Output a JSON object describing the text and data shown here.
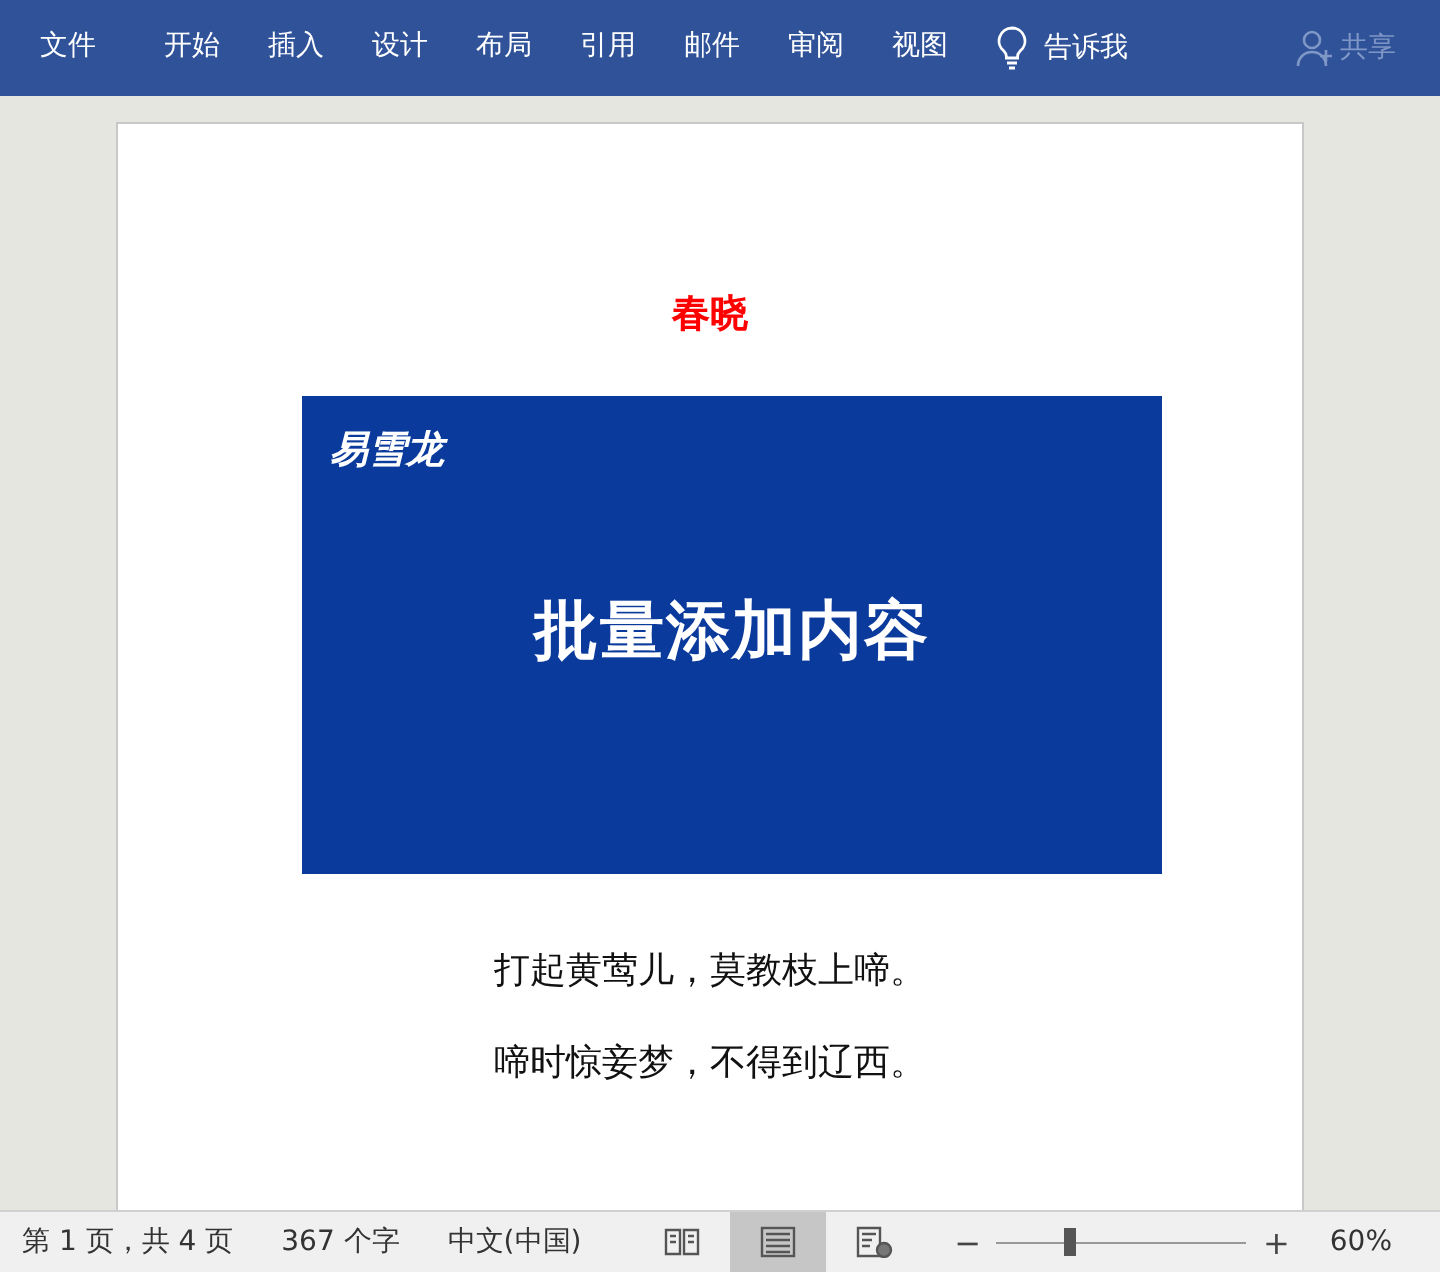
{
  "ribbon": {
    "tabs": [
      {
        "label": "文件",
        "selected": false
      },
      {
        "label": "开始",
        "selected": false
      },
      {
        "label": "插入",
        "selected": false
      },
      {
        "label": "设计",
        "selected": false
      },
      {
        "label": "布局",
        "selected": false
      },
      {
        "label": "引用",
        "selected": false
      },
      {
        "label": "邮件",
        "selected": false
      },
      {
        "label": "审阅",
        "selected": false
      },
      {
        "label": "视图",
        "selected": false
      }
    ],
    "tell_me": "告诉我",
    "share": {
      "label": "共享",
      "disabled": true
    }
  },
  "document": {
    "title": "春晓",
    "lines": [
      "打起黄莺儿，莫教枝上啼。",
      "啼时惊妾梦，不得到辽西。"
    ]
  },
  "overlay": {
    "brand": "易雪龙",
    "headline": "批量添加内容"
  },
  "status_bar": {
    "page": "第 1 页，共 4 页",
    "words": "367 个字",
    "language": "中文(中国)",
    "views": [
      {
        "kind": "read",
        "selected": false
      },
      {
        "kind": "print",
        "selected": true
      },
      {
        "kind": "web",
        "selected": false
      }
    ],
    "zoom": {
      "minus": "−",
      "plus": "+",
      "level": 0.29,
      "reading": "60%"
    }
  }
}
